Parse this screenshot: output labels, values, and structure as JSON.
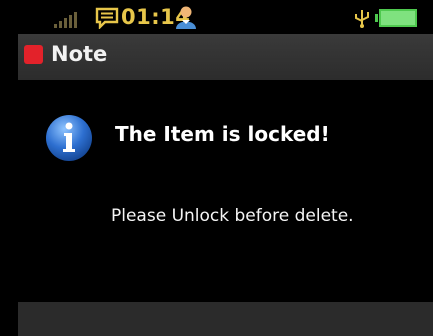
{
  "status": {
    "time": "01:14",
    "signal_icon": "signal-bars-icon",
    "message_icon": "message-icon",
    "user_icon": "user-icon",
    "usb_icon": "usb-icon",
    "battery_icon": "battery-icon",
    "time_color": "#e7c64a"
  },
  "titlebar": {
    "title": "Note",
    "icon": "note-icon",
    "icon_color": "#e3222a"
  },
  "dialog": {
    "icon": "info-icon",
    "heading": "The Item is locked!",
    "message": "Please Unlock before delete."
  }
}
